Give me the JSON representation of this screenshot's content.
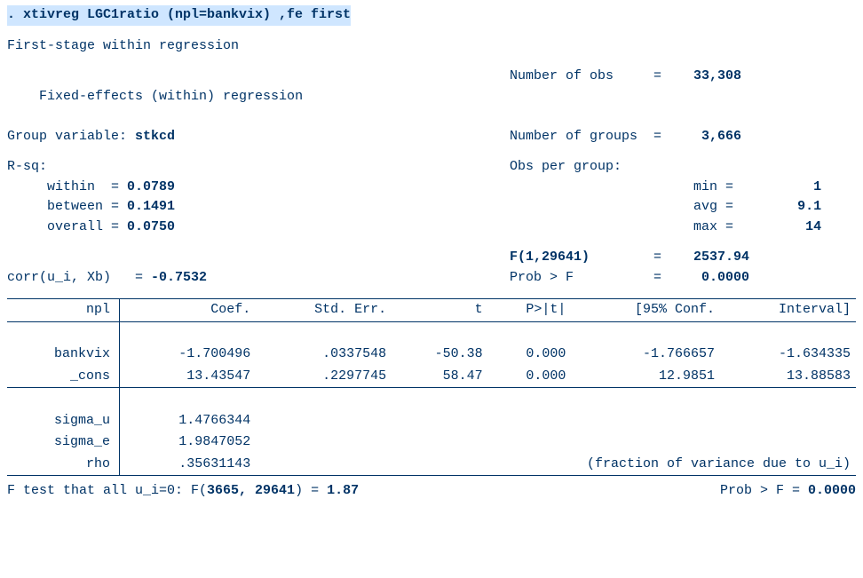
{
  "cmd": ". xtivreg  LGC1ratio   (npl=bankvix)  ,fe first",
  "title1": "First-stage within regression",
  "model_line": "Fixed-effects (within) regression",
  "group_var_label": "Group variable: ",
  "group_var": "stkcd",
  "nobs_label": "Number of obs     =",
  "nobs": "33,308",
  "ngroups_label": "Number of groups  =",
  "ngroups": "3,666",
  "rsq_label": "R-sq:",
  "rsq_within_label": "     within  = ",
  "rsq_within": "0.0789",
  "rsq_between_label": "     between = ",
  "rsq_between": "0.1491",
  "rsq_overall_label": "     overall = ",
  "rsq_overall": "0.0750",
  "obs_per_group_label": "Obs per group:",
  "min_label": "min =",
  "min_val": "1",
  "avg_label": "avg =",
  "avg_val": "9.1",
  "max_label": "max =",
  "max_val": "14",
  "fstat_label": "F(1,29641)",
  "fstat_val": "2537.94",
  "probf_label": "Prob > F",
  "probf_val": "0.0000",
  "corr_label": "corr(u_i, Xb)   = ",
  "corr_val": "-0.7532",
  "table": {
    "depvar": "npl",
    "headers": [
      "Coef.",
      "Std. Err.",
      "t",
      "P>|t|",
      "[95% Conf.",
      "Interval]"
    ],
    "rows": [
      {
        "var": "bankvix",
        "coef": "-1.700496",
        "se": ".0337548",
        "t": "-50.38",
        "p": "0.000",
        "lo": "-1.766657",
        "hi": "-1.634335"
      },
      {
        "var": "_cons",
        "coef": "13.43547",
        "se": ".2297745",
        "t": "58.47",
        "p": "0.000",
        "lo": "12.9851",
        "hi": "13.88583"
      }
    ],
    "sigma_u": {
      "label": "sigma_u",
      "val": "1.4766344"
    },
    "sigma_e": {
      "label": "sigma_e",
      "val": "1.9847052"
    },
    "rho": {
      "label": "rho",
      "val": ".35631143",
      "note": "(fraction of variance due to u_i)"
    }
  },
  "ftest_left1": "F test that all u_i=0: F(",
  "ftest_df": "3665, 29641",
  "ftest_mid": ") = ",
  "ftest_val": "1.87",
  "ftest_right_label": "Prob > F = ",
  "ftest_right_val": "0.0000",
  "chart_data": {
    "type": "table",
    "title": "First-stage within regression (xtivreg, fe first)",
    "columns": [
      "variable",
      "Coef.",
      "Std. Err.",
      "t",
      "P>|t|",
      "95% CI low",
      "95% CI high"
    ],
    "rows": [
      [
        "bankvix",
        -1.700496,
        0.0337548,
        -50.38,
        0.0,
        -1.766657,
        -1.634335
      ],
      [
        "_cons",
        13.43547,
        0.2297745,
        58.47,
        0.0,
        12.9851,
        13.88583
      ]
    ],
    "stats": {
      "N": 33308,
      "groups": 3666,
      "Rsq_within": 0.0789,
      "Rsq_between": 0.1491,
      "Rsq_overall": 0.075,
      "obs_per_group": {
        "min": 1,
        "avg": 9.1,
        "max": 14
      },
      "F": 2537.94,
      "F_df": [
        1,
        29641
      ],
      "Prob_F": 0.0,
      "corr_ui_Xb": -0.7532,
      "sigma_u": 1.4766344,
      "sigma_e": 1.9847052,
      "rho": 0.35631143,
      "Ftest_ui0": {
        "F": 1.87,
        "df": [
          3665,
          29641
        ],
        "Prob_F": 0.0
      }
    }
  }
}
